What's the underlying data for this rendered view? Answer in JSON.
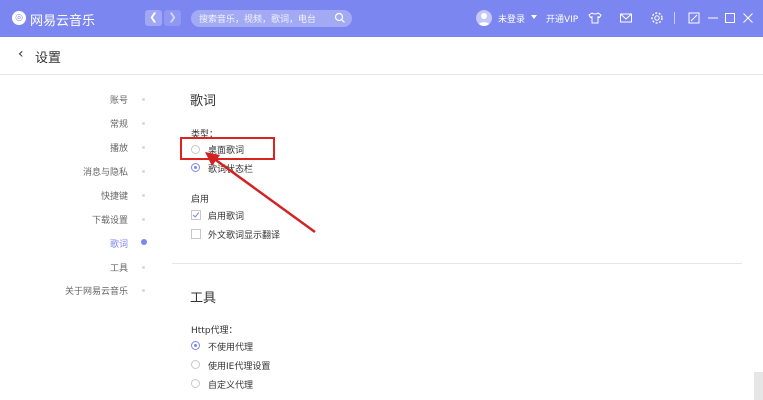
{
  "titlebar": {
    "app_title": "网易云音乐",
    "back_icon": "chevron-left-icon",
    "forward_icon": "chevron-right-icon",
    "search_placeholder": "搜索音乐，视频，歌词，电台",
    "username": "未登录",
    "vip_label": "开通VIP",
    "accent_color": "#7c86f0"
  },
  "header": {
    "title": "设置"
  },
  "sidebar": {
    "items": [
      {
        "label": "账号"
      },
      {
        "label": "常规"
      },
      {
        "label": "播放"
      },
      {
        "label": "消息与隐私"
      },
      {
        "label": "快捷键"
      },
      {
        "label": "下载设置"
      },
      {
        "label": "歌词",
        "active": true
      },
      {
        "label": "工具"
      },
      {
        "label": "关于网易云音乐"
      }
    ]
  },
  "lyrics": {
    "title": "歌词",
    "type_label": "类型：",
    "type_options": [
      {
        "label": "桌面歌词",
        "selected": false
      },
      {
        "label": "歌词状态栏",
        "selected": true
      }
    ],
    "enable_label": "启用",
    "enable_options": [
      {
        "label": "启用歌词",
        "checked": true
      },
      {
        "label": "外文歌词显示翻译",
        "checked": false
      }
    ]
  },
  "tools": {
    "title": "工具",
    "proxy_label": "Http代理：",
    "proxy_options": [
      {
        "label": "不使用代理",
        "selected": true
      },
      {
        "label": "使用IE代理设置",
        "selected": false
      },
      {
        "label": "自定义代理",
        "selected": false
      }
    ]
  },
  "annotation_color": "#d22222"
}
